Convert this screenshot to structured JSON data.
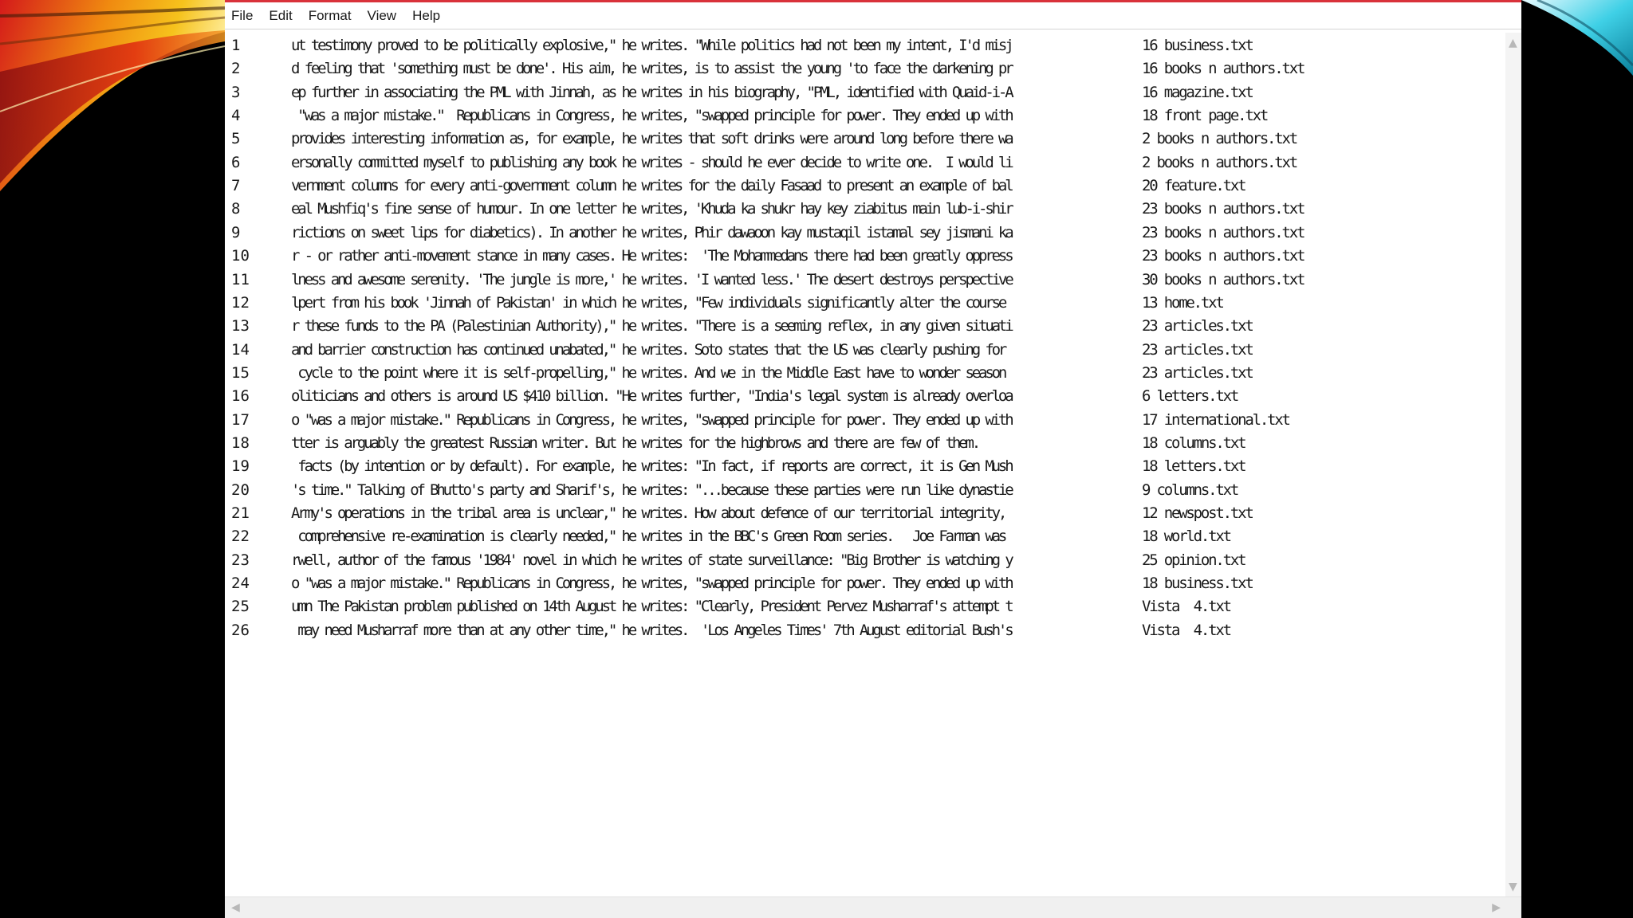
{
  "menu": [
    "File",
    "Edit",
    "Format",
    "View",
    "Help"
  ],
  "rows": [
    {
      "num": "1",
      "text": "ut testimony proved to be politically explosive,\" he writes. \"While politics had not been my intent, I'd misj",
      "file": "16 business.txt"
    },
    {
      "num": "2",
      "text": "d feeling that 'something must be done'. His aim, he writes, is to assist the young 'to face the darkening pr",
      "file": "16 books n authors.txt"
    },
    {
      "num": "3",
      "text": "ep further in associating the PML with Jinnah, as he writes in his biography, \"PML, identified with Quaid-i-A",
      "file": "16 magazine.txt"
    },
    {
      "num": "4",
      "text": " \"was a major mistake.\"  Republicans in Congress, he writes, \"swapped principle for power. They ended up with",
      "file": "18 front page.txt"
    },
    {
      "num": "5",
      "text": "provides interesting information as, for example, he writes that soft drinks were around long before there wa",
      "file": "2 books n authors.txt"
    },
    {
      "num": "6",
      "text": "ersonally committed myself to publishing any book he writes - should he ever decide to write one.  I would li",
      "file": "2 books n authors.txt"
    },
    {
      "num": "7",
      "text": "vernment columns for every anti-government column he writes for the daily Fasaad to present an example of bal",
      "file": "20 feature.txt"
    },
    {
      "num": "8",
      "text": "eal Mushfiq's fine sense of humour. In one letter he writes, 'Khuda ka shukr hay key ziabitus main lub-i-shir",
      "file": "23 books n authors.txt"
    },
    {
      "num": "9",
      "text": "rictions on sweet lips for diabetics). In another he writes, Phir dawaoon kay mustaqil istamal sey jismani ka",
      "file": "23 books n authors.txt"
    },
    {
      "num": "10",
      "text": "r - or rather anti-movement stance in many cases. He writes:  'The Mohammedans there had been greatly oppress",
      "file": "23 books n authors.txt"
    },
    {
      "num": "11",
      "text": "lness and awesome serenity. 'The jungle is more,' he writes. 'I wanted less.' The desert destroys perspective",
      "file": "30 books n authors.txt"
    },
    {
      "num": "12",
      "text": "lpert from his book 'Jinnah of Pakistan' in which he writes, \"Few individuals significantly alter the course",
      "file": "13 home.txt"
    },
    {
      "num": "13",
      "text": "r these funds to the PA (Palestinian Authority),\" he writes. \"There is a seeming reflex, in any given situati",
      "file": "23 articles.txt"
    },
    {
      "num": "14",
      "text": "and barrier construction has continued unabated,\" he writes. Soto states that the US was clearly pushing for",
      "file": "23 articles.txt"
    },
    {
      "num": "15",
      "text": " cycle to the point where it is self-propelling,\" he writes. And we in the Middle East have to wonder season",
      "file": "23 articles.txt"
    },
    {
      "num": "16",
      "text": "oliticians and others is around US $410 billion. \"He writes further, \"India's legal system is already overloa",
      "file": "6 letters.txt"
    },
    {
      "num": "17",
      "text": "o \"was a major mistake.\" Republicans in Congress, he writes, \"swapped principle for power. They ended up with",
      "file": "17 international.txt"
    },
    {
      "num": "18",
      "text": "tter is arguably the greatest Russian writer. But he writes for the highbrows and there are few of them.",
      "file": "18 columns.txt"
    },
    {
      "num": "19",
      "text": " facts (by intention or by default). For example, he writes: \"In fact, if reports are correct, it is Gen Mush",
      "file": "18 letters.txt"
    },
    {
      "num": "20",
      "text": "'s time.\" Talking of Bhutto's party and Sharif's, he writes: \"...because these parties were run like dynastie",
      "file": "9 columns.txt"
    },
    {
      "num": "21",
      "text": "Army's operations in the tribal area is unclear,\" he writes. How about defence of our territorial integrity,",
      "file": "12 newspost.txt"
    },
    {
      "num": "22",
      "text": " comprehensive re-examination is clearly needed,\" he writes in the BBC's Green Room series.   Joe Farman was",
      "file": "18 world.txt"
    },
    {
      "num": "23",
      "text": "rwell, author of the famous '1984' novel in which he writes of state surveillance: \"Big Brother is watching y",
      "file": "25 opinion.txt"
    },
    {
      "num": "24",
      "text": "o \"was a major mistake.\" Republicans in Congress, he writes, \"swapped principle for power. They ended up with",
      "file": "18 business.txt"
    },
    {
      "num": "25",
      "text": "umn The Pakistan problem published on 14th August he writes: \"Clearly, President Pervez Musharraf's attempt t",
      "file": "Vista  4.txt"
    },
    {
      "num": "26",
      "text": " may need Musharraf more than at any other time,\" he writes.  'Los Angeles Times' 7th August editorial Bush's",
      "file": "Vista  4.txt"
    }
  ],
  "colors": {
    "slide_background": "#000000",
    "window_background": "#ffffff",
    "window_top_border": "#d9323a",
    "text": "#1a1a1a"
  },
  "icons": {
    "scroll_up": "chevron-up-icon",
    "scroll_down": "chevron-down-icon",
    "scroll_left": "chevron-left-icon",
    "scroll_right": "chevron-right-icon"
  }
}
